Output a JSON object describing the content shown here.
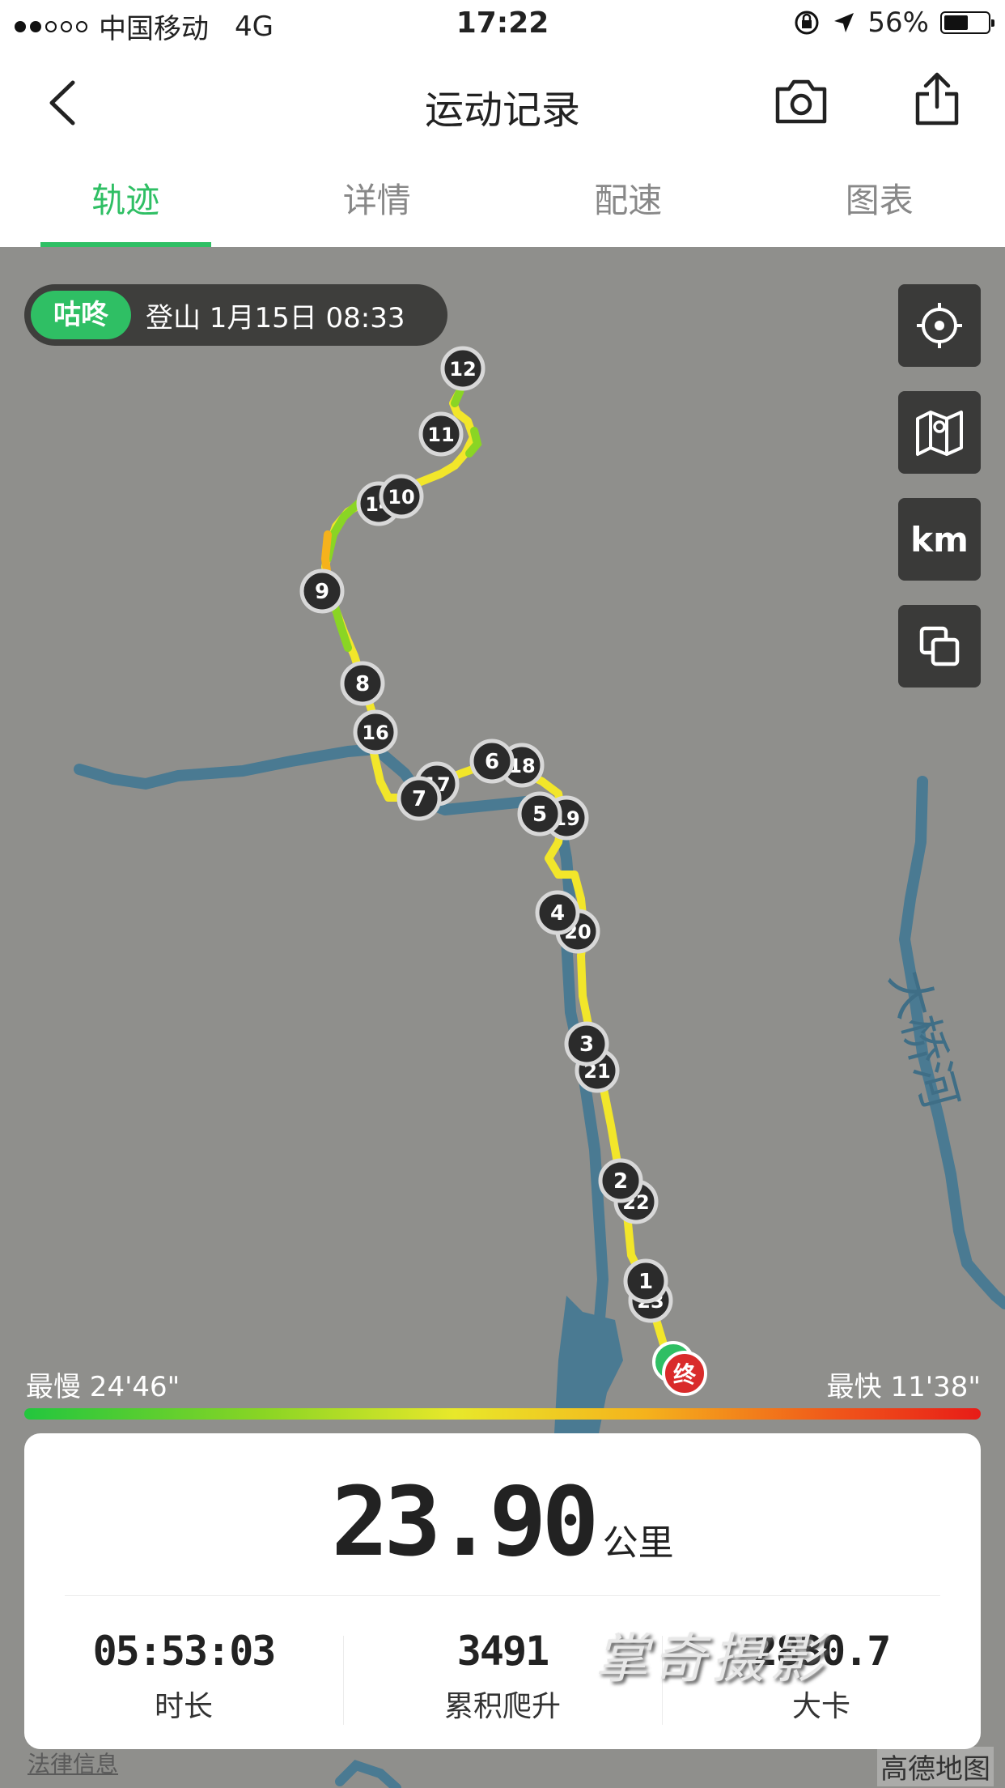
{
  "status_bar": {
    "carrier": "中国移动",
    "network": "4G",
    "time": "17:22",
    "battery": "56%",
    "battery_level": 0.56
  },
  "header": {
    "title": "运动记录",
    "back_icon": "chevron-left-icon",
    "camera_icon": "camera-icon",
    "share_icon": "share-icon"
  },
  "tabs": [
    {
      "label": "轨迹",
      "active": true
    },
    {
      "label": "详情",
      "active": false
    },
    {
      "label": "配速",
      "active": false
    },
    {
      "label": "图表",
      "active": false
    }
  ],
  "map": {
    "activity_badge": "咕咚",
    "activity_info": "登山 1月15日 08:33",
    "river_label": "大桥河",
    "end_marker": "终",
    "controls": {
      "locate_icon": "crosshair-icon",
      "map_style_icon": "map-icon",
      "unit_label": "km",
      "layers_icon": "layers-icon"
    },
    "km_markers": [
      "1",
      "2",
      "3",
      "4",
      "5",
      "6",
      "7",
      "8",
      "9",
      "10",
      "11",
      "12",
      "14",
      "16",
      "17",
      "18",
      "19",
      "20",
      "21",
      "22",
      "23"
    ],
    "slowest": "最慢 24'46\"",
    "fastest": "最快 11'38\"",
    "attribution": "高德地图",
    "legal": "法律信息",
    "colors": {
      "accent": "#2fbf64",
      "end_marker": "#d92b2b",
      "track_fast": "#f2e62a",
      "track_slow": "#8ad524",
      "river": "#4a7a92"
    }
  },
  "summary": {
    "distance": "23.90",
    "distance_unit": "公里",
    "stats": [
      {
        "value": "05:53:03",
        "label": "时长"
      },
      {
        "value": "3491",
        "label": "累积爬升"
      },
      {
        "value": "2830.7",
        "label": "大卡"
      }
    ]
  },
  "watermark": "掌奇摄影"
}
